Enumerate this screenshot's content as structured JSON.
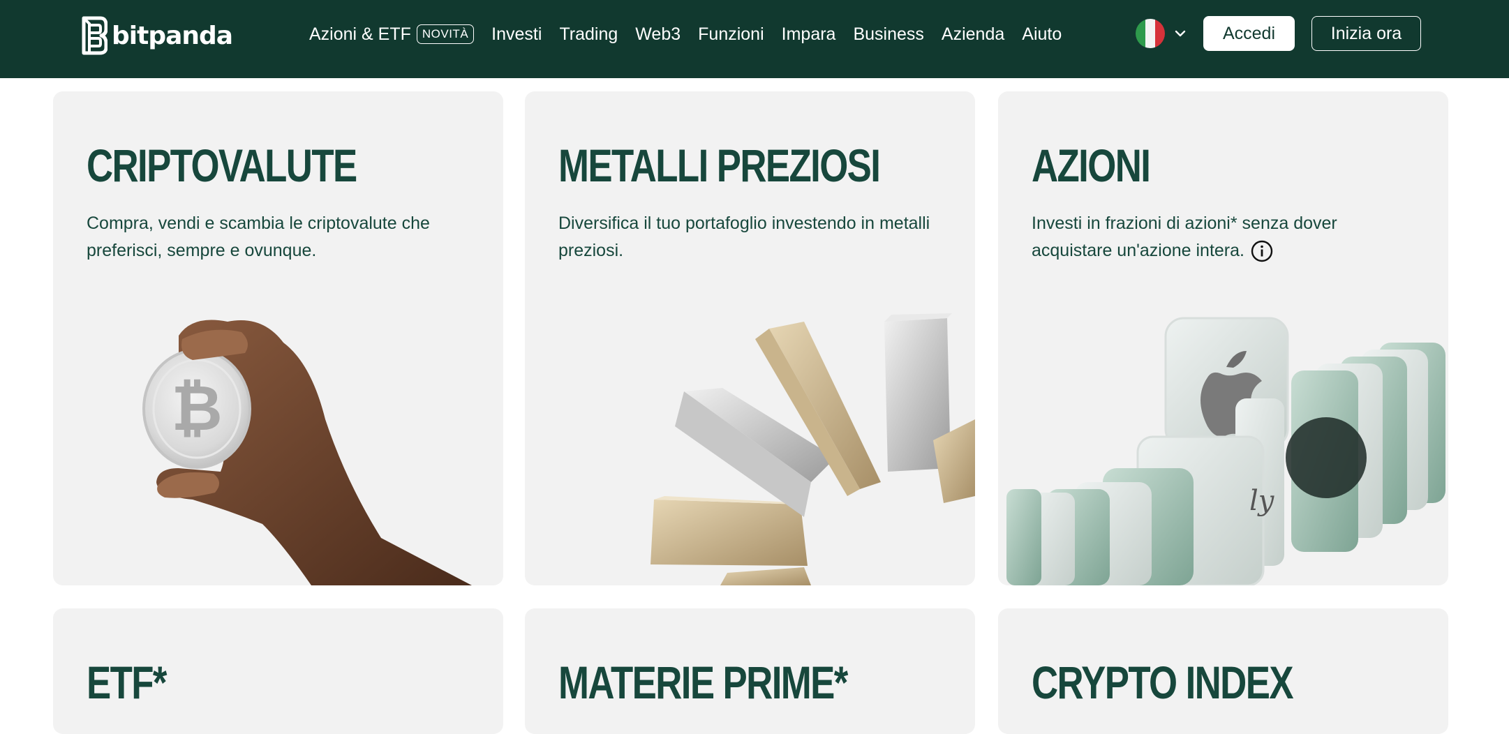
{
  "brand": {
    "name": "bitpanda"
  },
  "nav": {
    "items": [
      {
        "label": "Azioni & ETF",
        "badge": "NOVITÀ"
      },
      {
        "label": "Investi"
      },
      {
        "label": "Trading"
      },
      {
        "label": "Web3"
      },
      {
        "label": "Funzioni"
      },
      {
        "label": "Impara"
      },
      {
        "label": "Business"
      },
      {
        "label": "Azienda"
      },
      {
        "label": "Aiuto"
      }
    ]
  },
  "header": {
    "language": "Italiano",
    "login_label": "Accedi",
    "signup_label": "Inizia ora"
  },
  "cards": [
    {
      "title": "CRIPTOVALUTE",
      "desc": "Compra, vendi e scambia le criptovalute che preferisci, sempre e ovunque."
    },
    {
      "title": "METALLI PREZIOSI",
      "desc": "Diversifica il tuo portafoglio investendo in metalli preziosi."
    },
    {
      "title": "AZIONI",
      "desc": "Investi in frazioni di azioni* senza dover acquistare un'azione intera."
    },
    {
      "title": "ETF*"
    },
    {
      "title": "MATERIE PRIME*"
    },
    {
      "title": "CRYPTO INDEX"
    }
  ],
  "colors": {
    "header_bg": "#11392f",
    "card_bg": "#f2f2f2",
    "title_text": "#17473c"
  },
  "icons": {
    "logo": "bitpanda-b-icon",
    "language": "italy-flag-icon",
    "dropdown": "chevron-down-icon",
    "info": "info-icon"
  }
}
